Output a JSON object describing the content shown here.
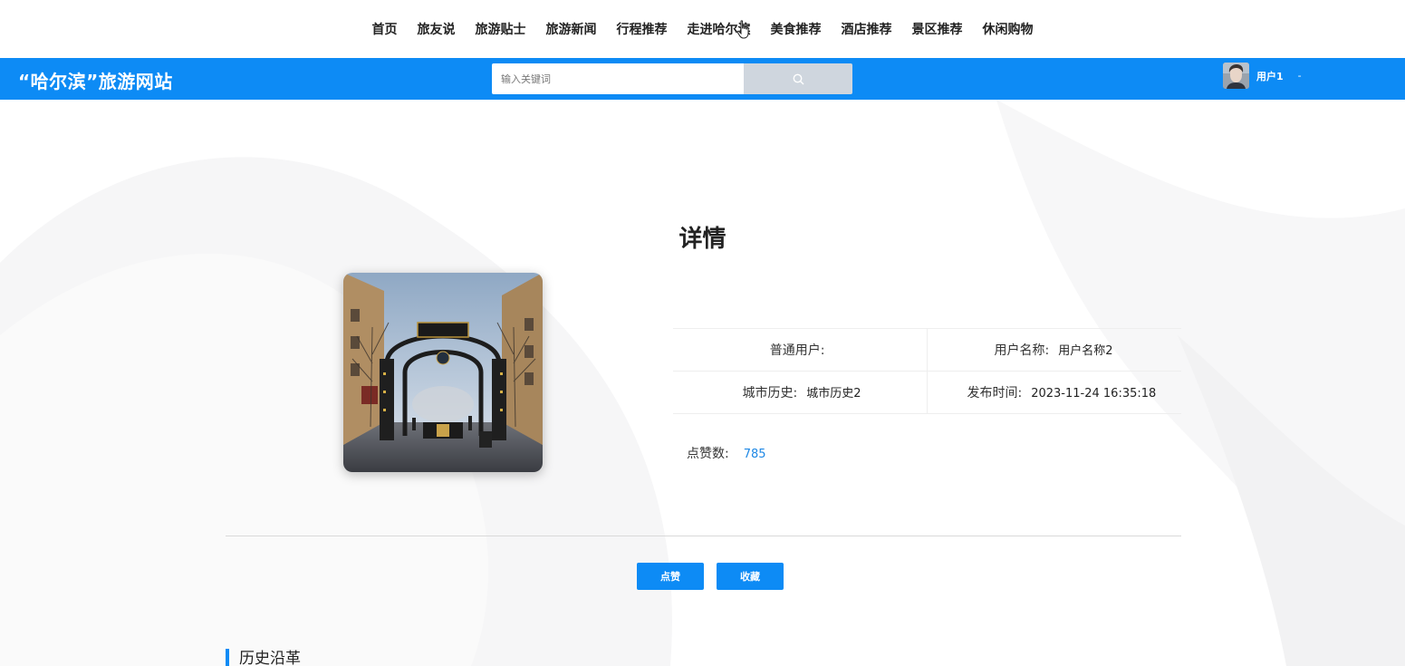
{
  "nav": {
    "items": [
      "首页",
      "旅友说",
      "旅游贴士",
      "旅游新闻",
      "行程推荐",
      "走进哈尔滨",
      "美食推荐",
      "酒店推荐",
      "景区推荐",
      "休闲购物"
    ]
  },
  "header": {
    "site_title": "“哈尔滨”旅游网站",
    "search_placeholder": "输入关键词",
    "search_icon": "search-icon",
    "user_name": "用户1",
    "user_caret": "-"
  },
  "detail": {
    "title": "详情",
    "fields": {
      "user_type_label": "普通用户:",
      "username_label": "用户名称:",
      "username_value": "用户名称2",
      "city_history_label": "城市历史:",
      "city_history_value": "城市历史2",
      "publish_time_label": "发布时间:",
      "publish_time_value": "2023-11-24 16:35:18",
      "likes_label": "点赞数:",
      "likes_value": "785"
    },
    "buttons": {
      "like": "点赞",
      "favorite": "收藏"
    },
    "section_title": "历史沿革"
  },
  "colors": {
    "accent": "#0d8bf5",
    "search_button": "#cfd6de",
    "link_value": "#1e88e5"
  }
}
